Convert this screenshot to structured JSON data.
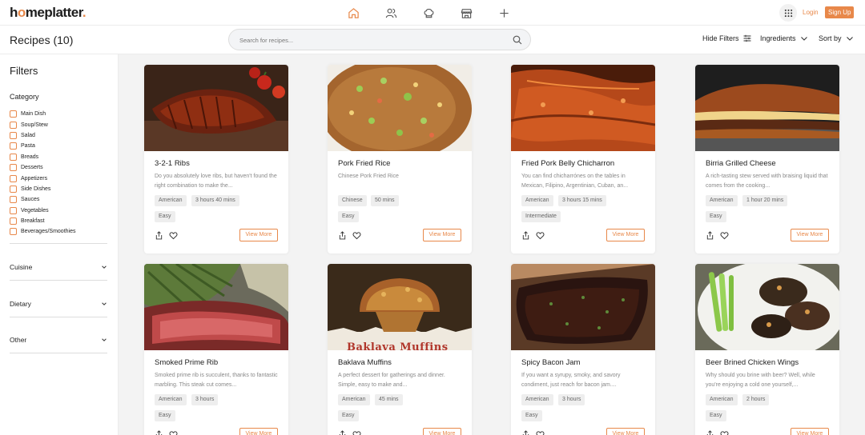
{
  "brand": {
    "logo_main": "h",
    "logo_accent_1": "o",
    "logo_rest": "meplatter",
    "logo_dot": ".",
    "accent_color": "#e8884a"
  },
  "topnav": {
    "icons": [
      "home-icon",
      "users-icon",
      "chef-hat-icon",
      "store-icon",
      "plus-icon"
    ],
    "apps_icon": "grid-icon",
    "login_label": "Login",
    "signup_label": "Sign Up"
  },
  "header": {
    "title": "Recipes (10)",
    "search_placeholder": "Search for recipes...",
    "hide_filters_label": "Hide Filters",
    "ingredients_label": "Ingredients",
    "sort_label": "Sort by"
  },
  "sidebar": {
    "title": "Filters",
    "category_title": "Category",
    "categories": [
      "Main Dish",
      "Soup/Stew",
      "Salad",
      "Pasta",
      "Breads",
      "Desserts",
      "Appetizers",
      "Side Dishes",
      "Sauces",
      "Vegetables",
      "Breakfast",
      "Beverages/Smoothies"
    ],
    "sections": [
      "Cuisine",
      "Dietary",
      "Other"
    ]
  },
  "recipes": [
    {
      "title": "3-2-1 Ribs",
      "desc": "Do you absolutely love ribs, but haven't found the right combination to make the...",
      "cuisine": "American",
      "time": "3 hours 40 mins",
      "difficulty": "Easy",
      "view_more": "View More"
    },
    {
      "title": "Pork Fried Rice",
      "desc": "Chinese Pork Fried Rice",
      "cuisine": "Chinese",
      "time": "50 mins",
      "difficulty": "Easy",
      "view_more": "View More"
    },
    {
      "title": "Fried Pork Belly Chicharron",
      "desc": "You can find chicharrónes on the tables in Mexican, Filipino, Argentinian, Cuban, an...",
      "cuisine": "American",
      "time": "3 hours 15 mins",
      "difficulty": "Intermediate",
      "view_more": "View More"
    },
    {
      "title": "Birria Grilled Cheese",
      "desc": "A rich-tasting stew served with braising liquid that comes from the cooking...",
      "cuisine": "American",
      "time": "1 hour 20 mins",
      "difficulty": "Easy",
      "view_more": "View More"
    },
    {
      "title": "Smoked Prime Rib",
      "desc": "Smoked prime rib is succulent, thanks to fantastic marbling. This steak cut comes...",
      "cuisine": "American",
      "time": "3 hours",
      "difficulty": "Easy",
      "view_more": "View More"
    },
    {
      "title": "Baklava Muffins",
      "desc": "A perfect dessert for gatherings and dinner. Simple, easy to make and...",
      "cuisine": "American",
      "time": "45 mins",
      "difficulty": "Easy",
      "view_more": "View More",
      "image_text": "Baklava Muffins"
    },
    {
      "title": "Spicy Bacon Jam",
      "desc": "If you want a syrupy, smoky, and savory condiment, just reach for bacon jam....",
      "cuisine": "American",
      "time": "3 hours",
      "difficulty": "Easy",
      "view_more": "View More"
    },
    {
      "title": "Beer Brined Chicken Wings",
      "desc": "Why should you brine with beer? Well, while you're enjoying a cold one yourself,...",
      "cuisine": "American",
      "time": "2 hours",
      "difficulty": "Easy",
      "view_more": "View More"
    }
  ]
}
